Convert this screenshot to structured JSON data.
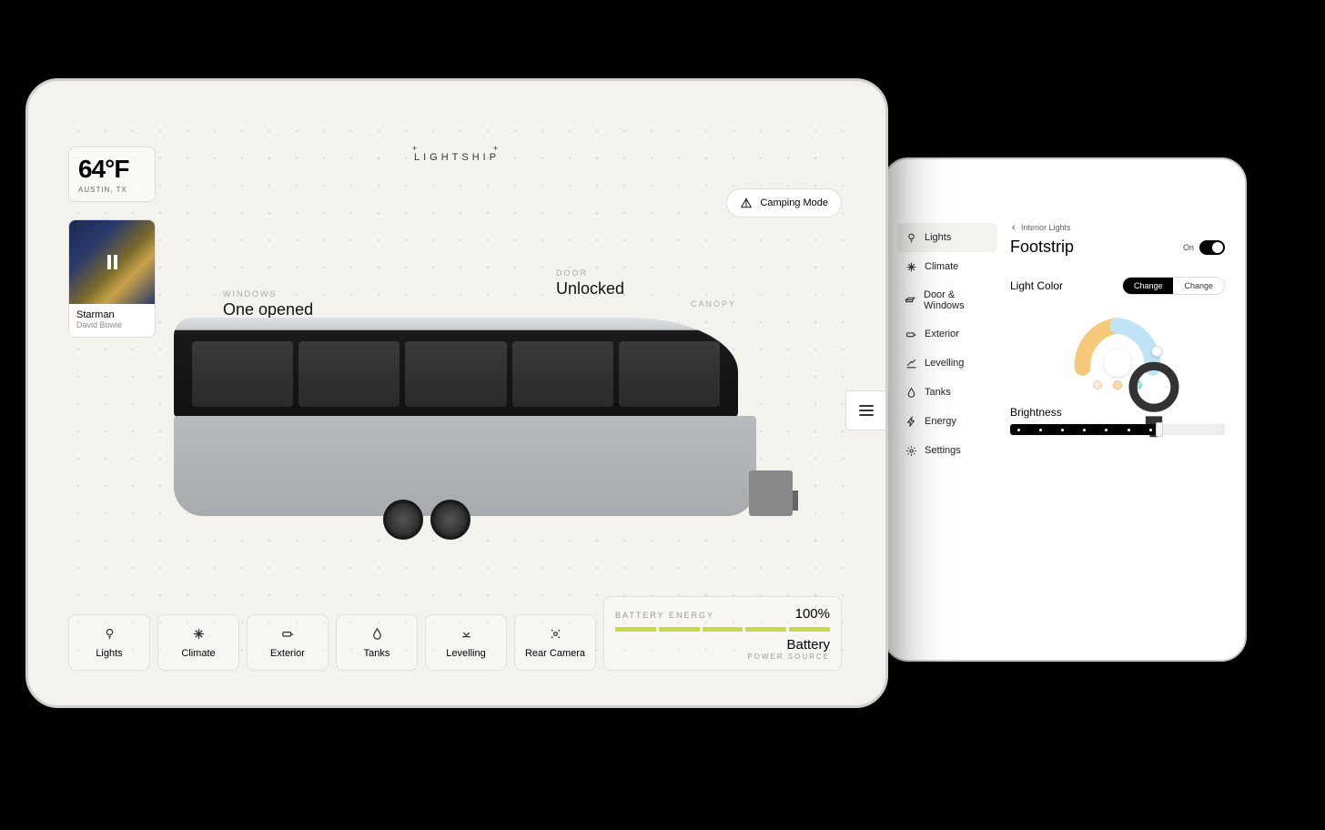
{
  "brand": "LIGHTSHIP",
  "weather": {
    "temp": "64°F",
    "location": "AUSTIN, TX"
  },
  "music": {
    "title": "Starman",
    "artist": "David Bowie",
    "state": "paused"
  },
  "mode": {
    "label": "Camping Mode"
  },
  "annotations": {
    "windows": {
      "label": "WINDOWS",
      "value": "One opened"
    },
    "door": {
      "label": "DOOR",
      "value": "Unlocked"
    },
    "canopy": {
      "label": "CANOPY"
    }
  },
  "actions": {
    "lights": "Lights",
    "climate": "Climate",
    "exterior": "Exterior",
    "tanks": "Tanks",
    "levelling": "Levelling",
    "rearcamera": "Rear Camera"
  },
  "battery": {
    "eyebrow": "BATTERY ENERGY",
    "percent": "100%",
    "source": "Battery",
    "caption": "POWER SOURCE"
  },
  "panel2": {
    "sidebar": {
      "lights": "Lights",
      "climate": "Climate",
      "doorwindows": "Door & Windows",
      "exterior": "Exterior",
      "levelling": "Levelling",
      "tanks": "Tanks",
      "energy": "Energy",
      "settings": "Settings"
    },
    "crumb": "Interior Lights",
    "title": "Footstrip",
    "toggle_label": "On",
    "lightcolor": {
      "label": "Light Color",
      "change": "Change",
      "change2": "Change"
    },
    "brightness": {
      "label": "Brightness"
    }
  }
}
